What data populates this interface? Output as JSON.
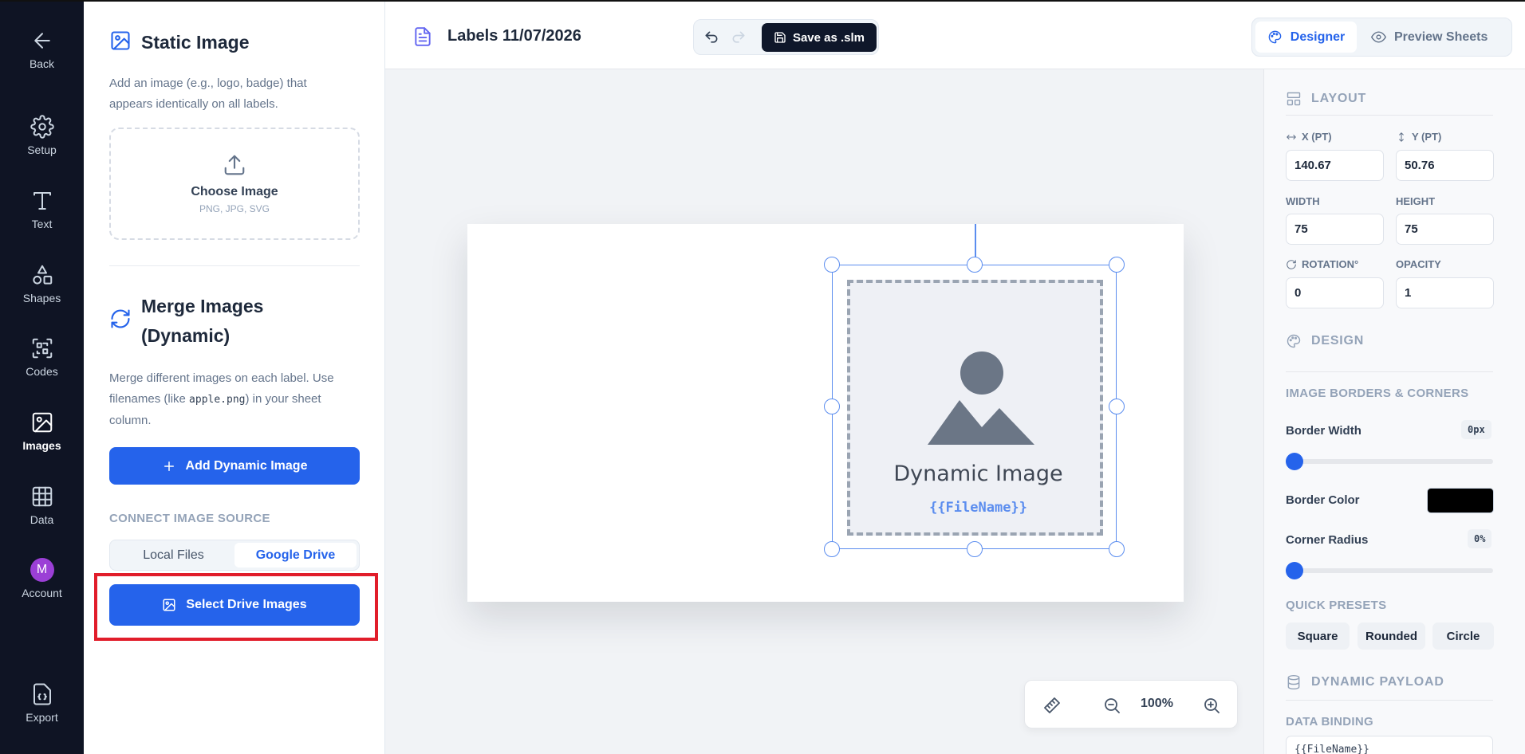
{
  "rail": {
    "back": "Back",
    "setup": "Setup",
    "text": "Text",
    "shapes": "Shapes",
    "codes": "Codes",
    "images": "Images",
    "data": "Data",
    "account": "Account",
    "avatar_initial": "M",
    "export": "Export"
  },
  "panel": {
    "static_title": "Static Image",
    "static_desc": "Add an image (e.g., logo, badge) that appears identically on all labels.",
    "choose_image": "Choose Image",
    "formats": "PNG, JPG, SVG",
    "merge_title": "Merge Images (Dynamic)",
    "merge_desc_1": "Merge different images on each label. Use filenames (like",
    "merge_desc_code": "apple.png",
    "merge_desc_2": ") in your sheet column.",
    "add_dynamic": "Add Dynamic Image",
    "connect_source": "CONNECT IMAGE SOURCE",
    "source_local": "Local Files",
    "source_drive": "Google Drive",
    "select_drive": "Select Drive Images"
  },
  "header": {
    "title": "Labels 11/07/2026",
    "save": "Save as .slm",
    "designer": "Designer",
    "preview": "Preview Sheets"
  },
  "canvas": {
    "placeholder_title": "Dynamic Image",
    "placeholder_binding": "{{FileName}}",
    "zoom": "100%"
  },
  "props": {
    "layout": "LAYOUT",
    "x_label": "X (PT)",
    "x_value": "140.67",
    "y_label": "Y (PT)",
    "y_value": "50.76",
    "width_label": "WIDTH",
    "width_value": "75",
    "height_label": "HEIGHT",
    "height_value": "75",
    "rotation_label": "ROTATION°",
    "rotation_value": "0",
    "opacity_label": "OPACITY",
    "opacity_value": "1",
    "design": "DESIGN",
    "borders_heading": "IMAGE BORDERS & CORNERS",
    "border_width_label": "Border Width",
    "border_width_value": "0px",
    "border_width_level": 0,
    "border_color_label": "Border Color",
    "border_color_value": "#000000",
    "corner_radius_label": "Corner Radius",
    "corner_radius_value": "0%",
    "corner_radius_level": 0,
    "presets_heading": "QUICK PRESETS",
    "preset_square": "Square",
    "preset_rounded": "Rounded",
    "preset_circle": "Circle",
    "payload_heading": "DYNAMIC PAYLOAD",
    "binding_heading": "DATA BINDING",
    "binding_value": "{{FileName}}"
  },
  "colors": {
    "accent": "#2563eb",
    "rail_bg": "#0f1424",
    "highlight": "#e11d2a",
    "selection": "#5b8def"
  }
}
